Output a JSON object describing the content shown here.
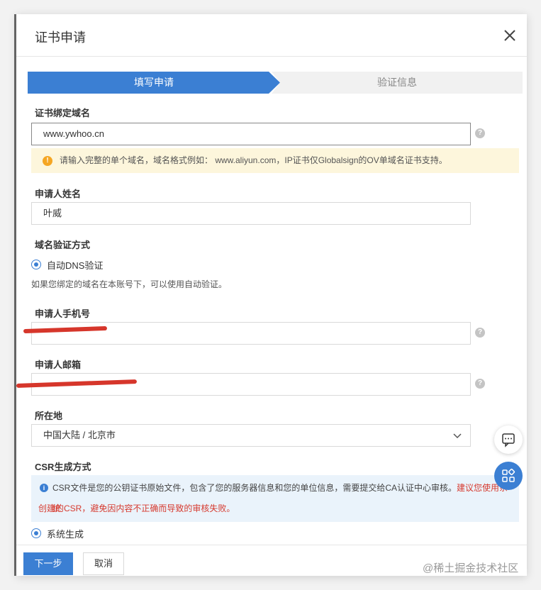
{
  "dialog": {
    "title": "证书申请"
  },
  "steps": {
    "active": "填写申请",
    "next": "验证信息"
  },
  "form": {
    "domain": {
      "label": "证书绑定域名",
      "value": "www.ywhoo.cn"
    },
    "domain_warning": "请输入完整的单个域名，域名格式例如： www.aliyun.com，IP证书仅Globalsign的OV单域名证书支持。",
    "applicant_name": {
      "label": "申请人姓名",
      "value": "叶威"
    },
    "verification": {
      "label": "域名验证方式",
      "option": "自动DNS验证",
      "hint": "如果您绑定的域名在本账号下，可以使用自动验证。"
    },
    "phone": {
      "label": "申请人手机号",
      "value": ""
    },
    "email": {
      "label": "申请人邮箱",
      "value": ""
    },
    "location": {
      "label": "所在地",
      "value": "中国大陆 / 北京市"
    },
    "csr": {
      "label": "CSR生成方式",
      "info_text": "CSR文件是您的公钥证书原始文件，包含了您的服务器信息和您的单位信息，需要提交给CA认证中心审核。",
      "info_red": "建议您使用系统",
      "info_red_line2": "创建的CSR，避免因内容不正确而导致的审核失败。",
      "option": "系统生成"
    }
  },
  "footer": {
    "next_label": "下一步",
    "cancel_label": "取消"
  },
  "watermark": "@稀土掘金技术社区",
  "colors": {
    "primary": "#3b7fd3",
    "warning_bg": "#fdf6dc",
    "info_bg": "#eaf3fb",
    "danger": "#d63a2f"
  },
  "icons": {
    "close": "close-icon",
    "help": "question-icon",
    "warning": "warning-icon",
    "info": "info-icon",
    "chevron": "chevron-down-icon",
    "chat": "chat-icon",
    "apps": "apps-icon"
  }
}
